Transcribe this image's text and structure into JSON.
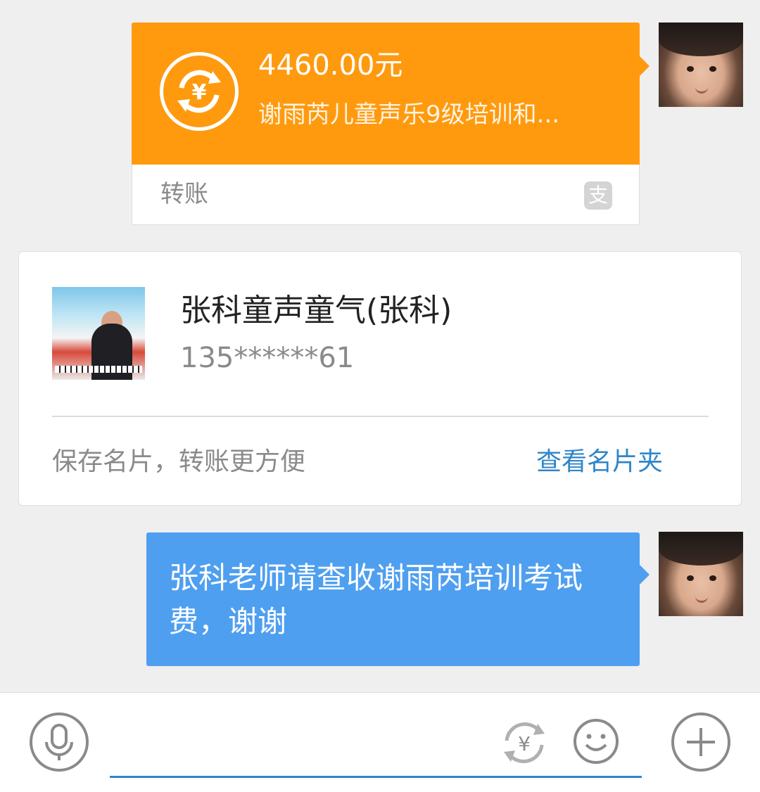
{
  "transfer": {
    "amount": "4460.00元",
    "description": "谢雨芮儿童声乐9级培训和...",
    "label": "转账",
    "icon": "yuan-exchange-icon",
    "brand_icon": "alipay-icon",
    "accent_color": "#ff9a0f"
  },
  "contact_card": {
    "name": "张科童声童气(张科)",
    "phone": "135******61",
    "hint": "保存名片，转账更方便",
    "link": "查看名片夹",
    "link_color": "#2f86c9"
  },
  "message": {
    "text": "张科老师请查收谢雨芮培训考试费，谢谢",
    "bubble_color": "#4f9ff0"
  },
  "input_bar": {
    "icons": [
      "microphone-icon",
      "yuan-transfer-icon",
      "smiley-icon",
      "plus-icon"
    ],
    "underline_color": "#2f86c9"
  }
}
